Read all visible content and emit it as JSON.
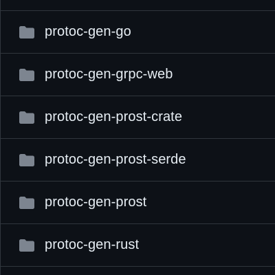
{
  "file_list": {
    "items": [
      {
        "name": "protoc-gen-go",
        "icon": "folder-icon"
      },
      {
        "name": "protoc-gen-grpc-web",
        "icon": "folder-icon"
      },
      {
        "name": "protoc-gen-prost-crate",
        "icon": "folder-icon"
      },
      {
        "name": "protoc-gen-prost-serde",
        "icon": "folder-icon"
      },
      {
        "name": "protoc-gen-prost",
        "icon": "folder-icon"
      },
      {
        "name": "protoc-gen-rust",
        "icon": "folder-icon"
      }
    ]
  },
  "colors": {
    "background": "#0d1117",
    "border": "#30363d",
    "text": "#e6edf3",
    "folder_icon": "#7d8590"
  }
}
